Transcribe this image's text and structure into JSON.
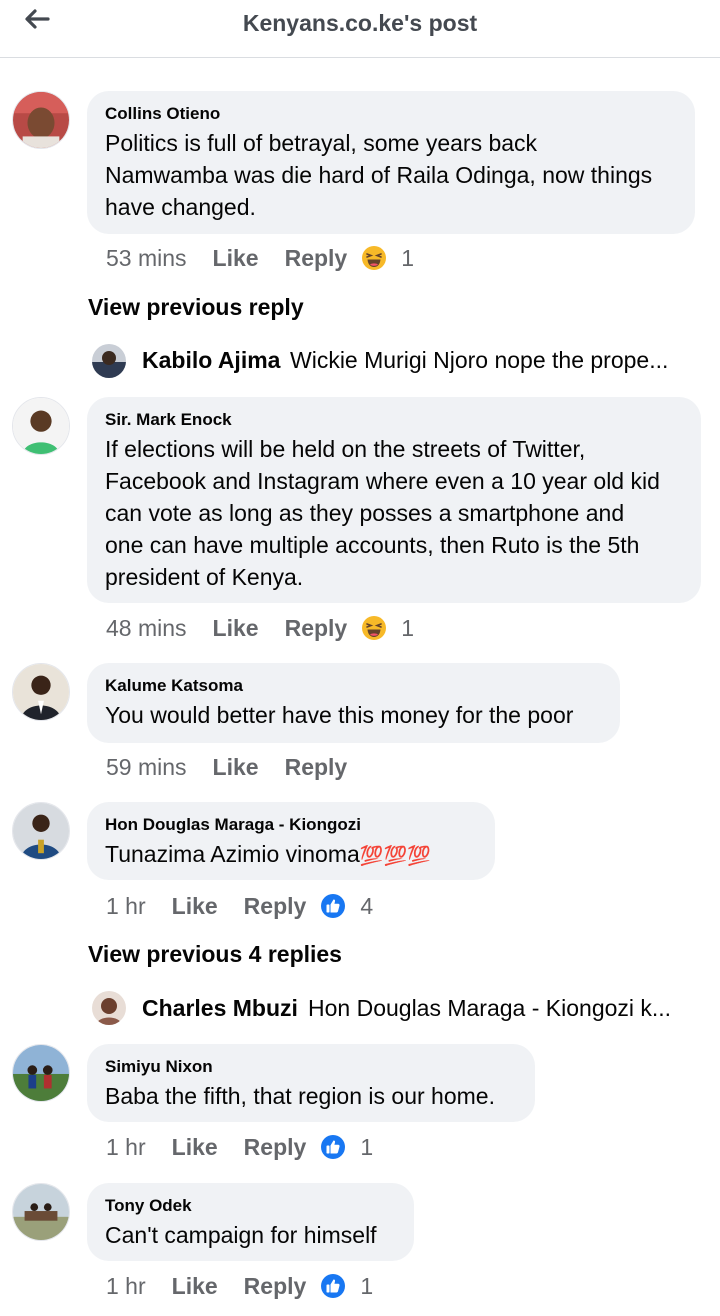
{
  "header": {
    "title": "Kenyans.co.ke's post"
  },
  "comments": [
    {
      "author": "Collins Otieno",
      "lines": [
        "Politics is full of betrayal, some years back",
        "Namwamba was die hard of Raila Odinga, now things",
        "have changed."
      ],
      "time": "53 mins",
      "like": "Like",
      "reply": "Reply",
      "reaction": "haha-icon",
      "count": "1"
    },
    {
      "author": "Sir. Mark Enock",
      "lines": [
        "If elections will be held on the streets of Twitter,",
        "Facebook and Instagram where even a 10 year old kid",
        "can  vote as long as they posses a smartphone and",
        "one can have multiple accounts, then Ruto is the 5th",
        "president of Kenya."
      ],
      "time": "48 mins",
      "like": "Like",
      "reply": "Reply",
      "reaction": "haha-icon",
      "count": "1"
    },
    {
      "author": "Kalume Katsoma",
      "lines": [
        "You would better have this money for the poor"
      ],
      "time": "59 mins",
      "like": "Like",
      "reply": "Reply"
    },
    {
      "author": "Hon Douglas Maraga - Kiongozi",
      "lines": [
        "Tunazima Azimio vinoma"
      ],
      "emoji": "💯💯💯",
      "time": "1 hr",
      "like": "Like",
      "reply": "Reply",
      "reaction": "like-icon",
      "count": "4"
    },
    {
      "author": "Simiyu Nixon",
      "lines": [
        "Baba the fifth, that region is our home."
      ],
      "time": "1 hr",
      "like": "Like",
      "reply": "Reply",
      "reaction": "like-icon",
      "count": "1"
    },
    {
      "author": "Tony Odek",
      "lines": [
        "Can't campaign for himself"
      ],
      "time": "1 hr",
      "like": "Like",
      "reply": "Reply",
      "reaction": "like-icon",
      "count": "1"
    }
  ],
  "view_previous": [
    "View previous reply",
    "View previous 4 replies"
  ],
  "reply_previews": [
    {
      "name": "Kabilo Ajima",
      "text": "Wickie Murigi Njoro nope the prope..."
    },
    {
      "name": "Charles Mbuzi",
      "text": "Hon Douglas Maraga - Kiongozi k..."
    }
  ],
  "colors": {
    "bubble": "#f0f2f5",
    "meta": "#65676b",
    "like_blue": "#1877f2",
    "haha_yellow": "#f7b928"
  }
}
